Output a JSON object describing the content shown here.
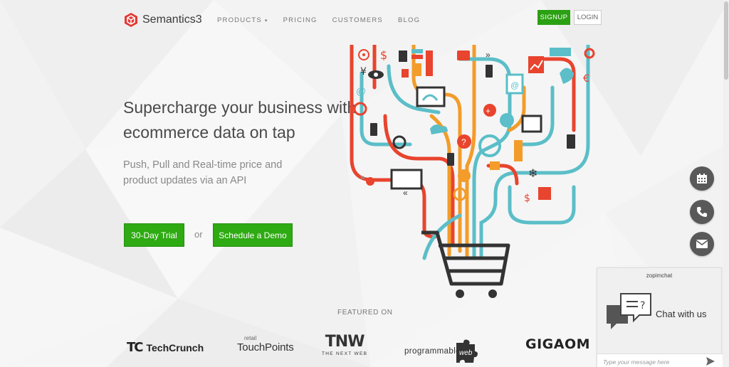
{
  "brand": {
    "name": "Semantics3",
    "color": "#e53935"
  },
  "nav": {
    "links": [
      "PRODUCTS",
      "PRICING",
      "CUSTOMERS",
      "BLOG"
    ],
    "products_caret": "▾",
    "signup": "SIGNUP",
    "login": "LOGIN"
  },
  "hero": {
    "title": "Supercharge your business with ecommerce data on tap",
    "subtitle": "Push, Pull and Real-time price and product updates via an API",
    "trial_button": "30-Day Trial",
    "or": "or",
    "demo_button": "Schedule a Demo"
  },
  "featured": {
    "label": "FEATURED ON",
    "logos": {
      "techcrunch_mark": "TC",
      "techcrunch": "TechCrunch",
      "touchpoints_small": "retail",
      "touchpoints": "TouchPoints",
      "tnw": "TNW",
      "tnw_sub": "THE NEXT WEB",
      "programmableweb": "programmable",
      "programmableweb_web": "web",
      "gigaom": "GIGAOM"
    }
  },
  "float_buttons": [
    "calendar-icon",
    "phone-icon",
    "mail-icon"
  ],
  "chat": {
    "brand": "zopimchat",
    "label": "Chat with us",
    "placeholder": "Type your message here"
  },
  "colors": {
    "accent_green": "#2eaa12",
    "illus_red": "#e8442e",
    "illus_orange": "#f39c2a",
    "illus_teal": "#5bbec8",
    "illus_dark": "#333333"
  }
}
